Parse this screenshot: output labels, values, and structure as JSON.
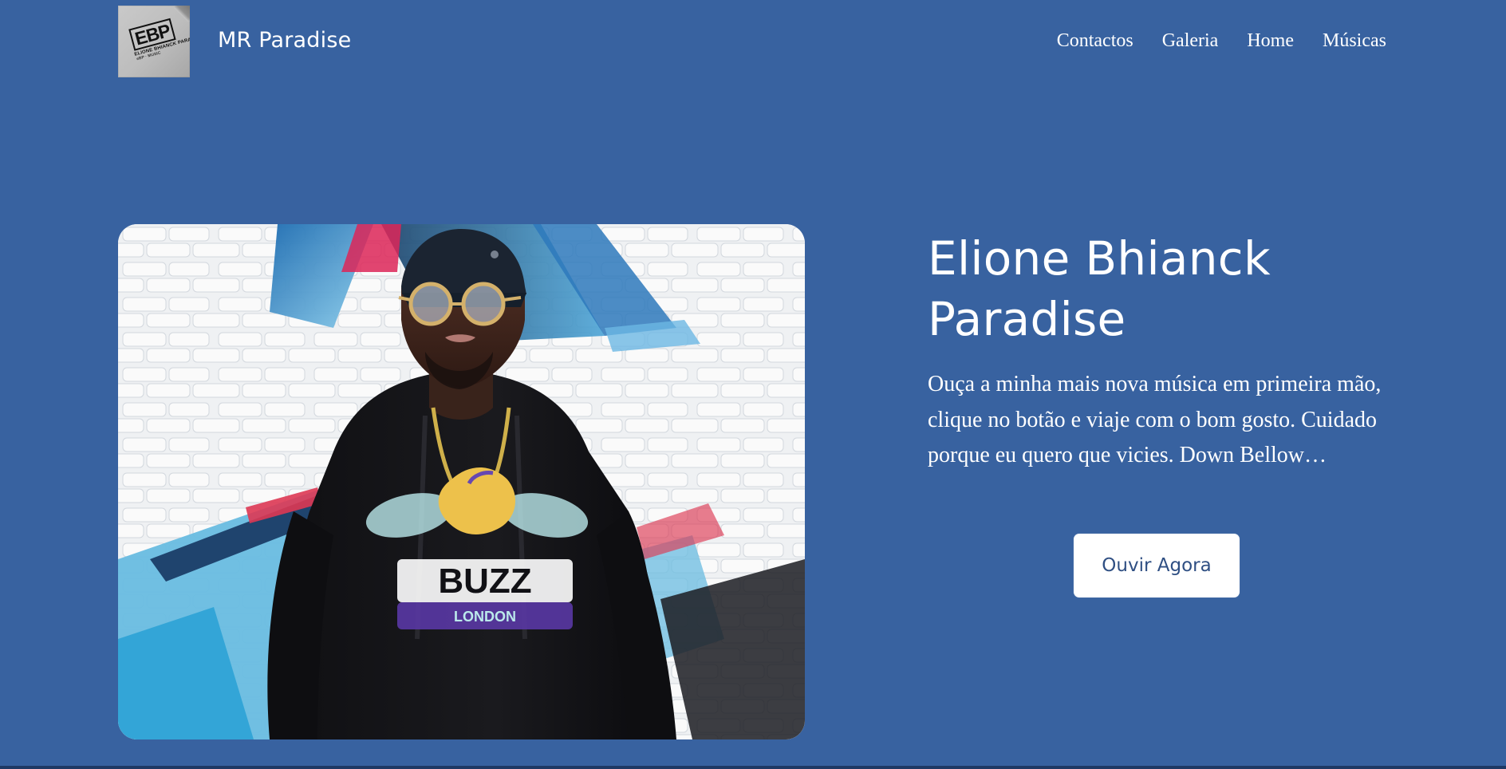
{
  "header": {
    "logo_text": "EBP",
    "logo_subtext": "ELIONE BHIANCK PARADISE",
    "logo_subtext_small": "eBP · MUSIC",
    "site_name": "MR Paradise",
    "nav": [
      {
        "label": "Contactos"
      },
      {
        "label": "Galeria"
      },
      {
        "label": "Home"
      },
      {
        "label": "Músicas"
      }
    ]
  },
  "hero": {
    "title_line1": "Elione Bhianck",
    "title_line2": "Paradise",
    "description": "Ouça a minha mais nova música em primeira mão, clique no botão e viaje com o bom gosto. Cuidado porque eu quero que vicies. Down Bellow…",
    "button_label": "Ouvir Agora",
    "image_hoodie_text": "BUZZ",
    "image_hoodie_subtext": "LONDON"
  },
  "colors": {
    "page_bg": "#3862a0",
    "button_text": "#2f4f83",
    "white": "#ffffff"
  }
}
